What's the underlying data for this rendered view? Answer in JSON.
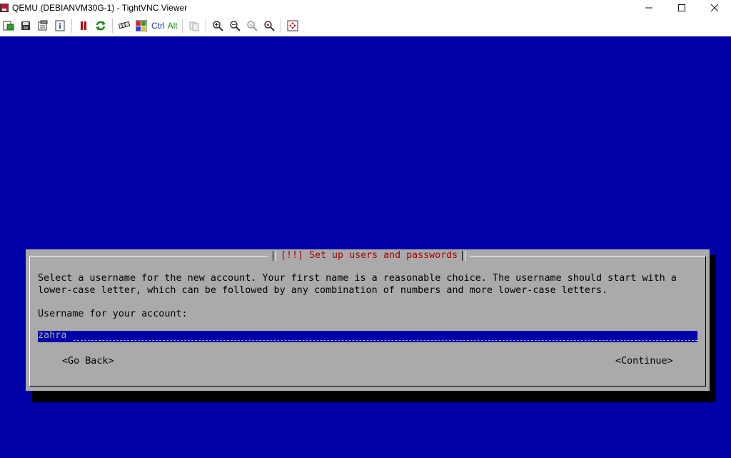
{
  "window": {
    "title": "QEMU (DEBIANVM30G-1) - TightVNC Viewer",
    "icon": "tightvnc-app-icon"
  },
  "toolbar": {
    "ctrl_label": "Ctrl",
    "alt_label": "Alt",
    "icons": [
      "new-connection-icon",
      "save-icon",
      "options-icon",
      "connection-info-icon",
      "pause-icon",
      "refresh-icon",
      "send-ctrl-alt-del-icon",
      "send-ctrl-esc-icon",
      "ctrl-key-icon",
      "alt-key-icon",
      "clipboard-icon",
      "zoom-in-icon",
      "zoom-out-icon",
      "zoom-100-icon",
      "zoom-fit-icon",
      "fullscreen-icon"
    ]
  },
  "installer": {
    "dialog_title": "[!!] Set up users and passwords",
    "description_line1": "Select a username for the new account. Your first name is a reasonable choice. The username should start with a",
    "description_line2": "lower-case letter, which can be followed by any combination of numbers and more lower-case letters.",
    "prompt": "Username for your account:",
    "username_value": "zahra",
    "go_back_label": "<Go Back>",
    "continue_label": "<Continue>"
  },
  "colors": {
    "screen_bg": "#0000a8",
    "dialog_bg": "#aaaaaa",
    "title_red": "#a80000",
    "input_bg": "#0000a8"
  }
}
